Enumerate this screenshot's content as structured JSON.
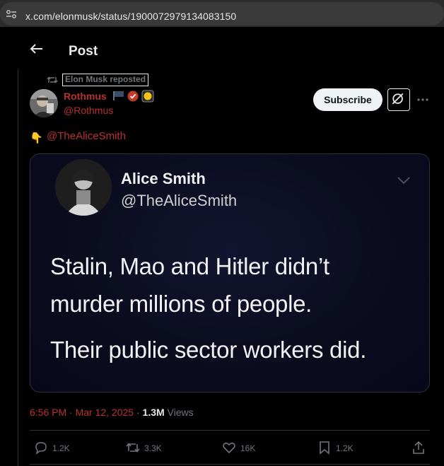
{
  "browser": {
    "url": "x.com/elonmusk/status/1900072979134083150"
  },
  "header": {
    "title": "Post"
  },
  "repost": {
    "label": "Elon Musk reposted"
  },
  "author": {
    "name": "Rothmus",
    "handle": "@Rothmus"
  },
  "buttons": {
    "subscribe": "Subscribe"
  },
  "tweet": {
    "emoji": "👇",
    "mention": "@TheAliceSmith"
  },
  "quoted": {
    "name": "Alice Smith",
    "handle": "@TheAliceSmith",
    "line1": "Stalin, Mao and Hitler didn’t",
    "line2": "murder millions of people.",
    "line3": "Their public sector workers did."
  },
  "meta": {
    "time": "6:56 PM · Mar 12, 2025",
    "separator": " · ",
    "views_count": "1.3M",
    "views_label": " Views"
  },
  "actions": {
    "replies": "1.2K",
    "reposts": "3.3K",
    "likes": "16K",
    "bookmarks": "1.2K"
  },
  "colors": {
    "accent_red": "#b8312f",
    "text_primary": "#e7e9ea",
    "text_secondary": "#71767b",
    "background": "#000000",
    "verified_red": "#c0392b",
    "badge_yellow": "#f5c518"
  }
}
